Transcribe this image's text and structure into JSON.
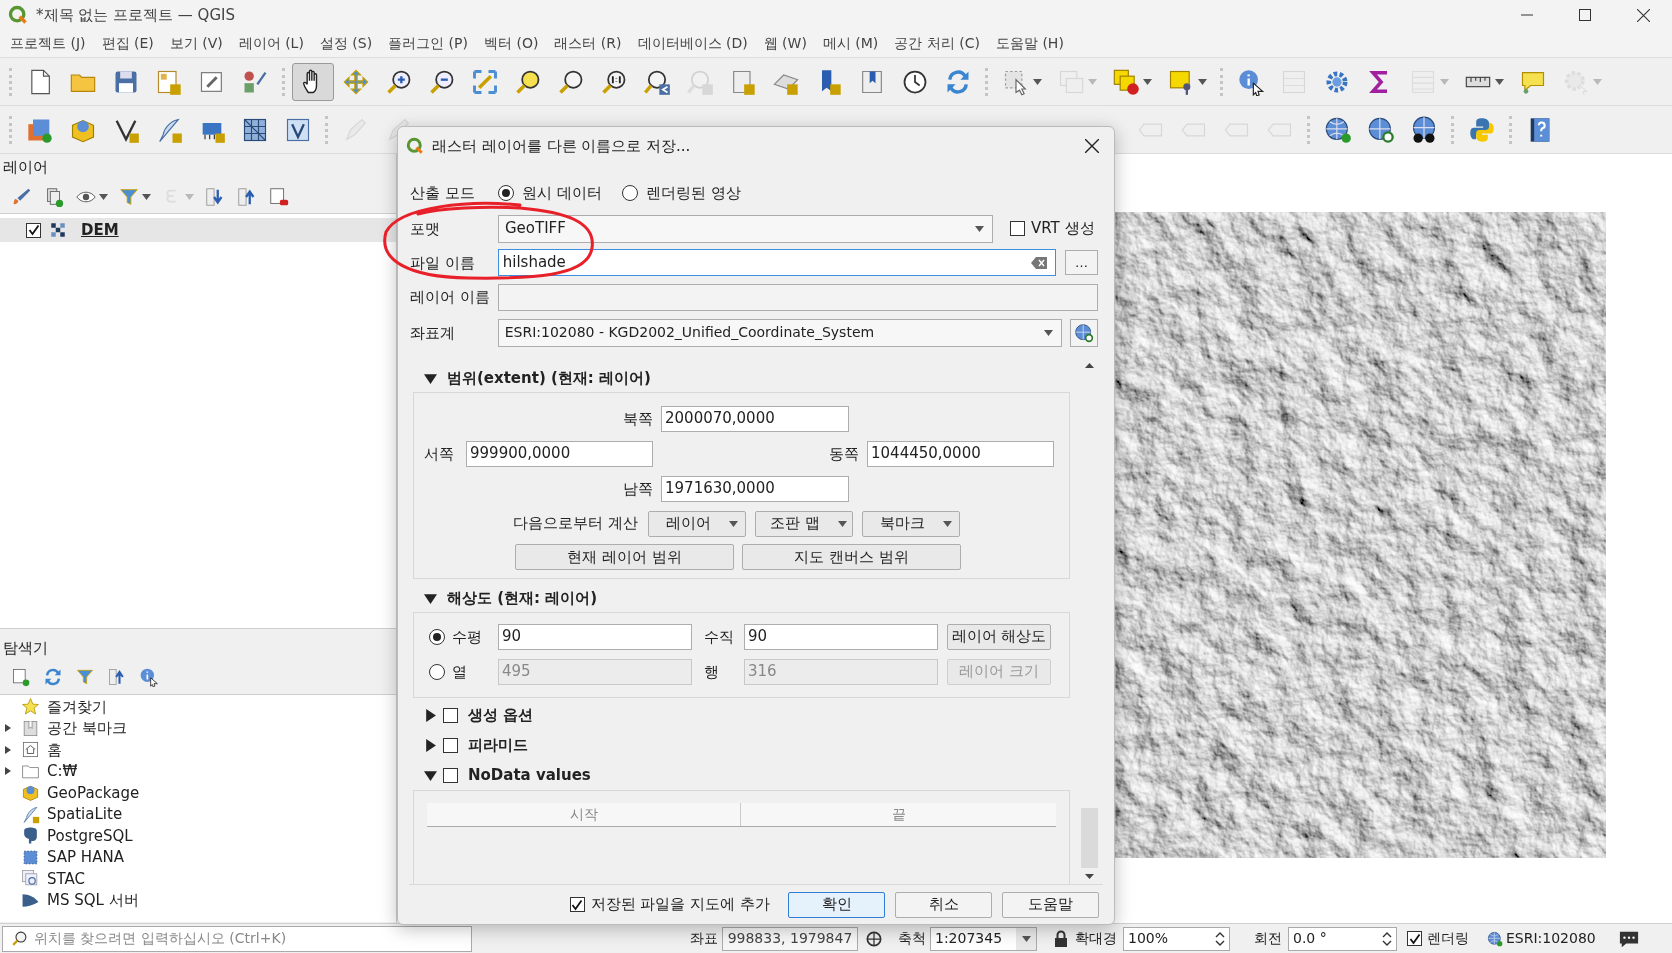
{
  "window": {
    "title": "*제목 없는 프로젝트 — QGIS"
  },
  "menu": [
    "프로젝트 (J)",
    "편집 (E)",
    "보기 (V)",
    "레이어 (L)",
    "설정 (S)",
    "플러그인 (P)",
    "벡터 (O)",
    "래스터 (R)",
    "데이터베이스 (D)",
    "웹 (W)",
    "메시 (M)",
    "공간 처리 (C)",
    "도움말 (H)"
  ],
  "toolbars": [
    {
      "tools": [
        {
          "selected": false,
          "disabled": false
        },
        {
          "selected": false,
          "disabled": false
        },
        {
          "selected": false,
          "disabled": false
        },
        {
          "selected": false,
          "disabled": false
        },
        {
          "selected": false,
          "disabled": false
        },
        {
          "selected": false,
          "disabled": false
        },
        {
          "selected": true,
          "disabled": false
        },
        {
          "selected": false,
          "disabled": false
        },
        {
          "selected": false,
          "disabled": false
        },
        {
          "selected": false,
          "disabled": false
        },
        {
          "selected": false,
          "disabled": false
        },
        {
          "selected": false,
          "disabled": false
        },
        {
          "selected": false,
          "disabled": false
        },
        {
          "selected": false,
          "disabled": false
        },
        {
          "selected": false,
          "disabled": false
        },
        {
          "selected": false,
          "disabled": true
        },
        {
          "selected": false,
          "disabled": false
        },
        {
          "selected": false,
          "disabled": false
        },
        {
          "selected": false,
          "disabled": false
        },
        {
          "selected": false,
          "disabled": false
        },
        {
          "selected": false,
          "disabled": false
        },
        {
          "selected": false,
          "disabled": false
        },
        {
          "selected": false,
          "disabled": false
        },
        {
          "selected": false,
          "disabled": true
        },
        {
          "selected": false,
          "disabled": false
        },
        {
          "selected": false,
          "disabled": false
        },
        {
          "selected": false,
          "disabled": false
        },
        {
          "selected": false,
          "disabled": true
        },
        {
          "selected": false,
          "disabled": false
        },
        {
          "selected": false,
          "disabled": false
        },
        {
          "selected": false,
          "disabled": true
        },
        {
          "selected": false,
          "disabled": false
        },
        {
          "selected": false,
          "disabled": false
        },
        {
          "selected": false,
          "disabled": true
        }
      ]
    },
    {
      "tools": [
        {
          "selected": false,
          "disabled": false
        },
        {
          "selected": false,
          "disabled": false
        },
        {
          "selected": false,
          "disabled": false
        },
        {
          "selected": false,
          "disabled": false
        },
        {
          "selected": false,
          "disabled": false
        },
        {
          "selected": false,
          "disabled": false
        },
        {
          "selected": false,
          "disabled": false
        },
        {
          "selected": false,
          "disabled": true
        },
        {
          "selected": false,
          "disabled": true
        },
        {
          "selected": false,
          "disabled": true
        },
        {
          "selected": false,
          "disabled": true
        },
        {
          "selected": false,
          "disabled": true
        },
        {
          "selected": false,
          "disabled": true
        },
        {
          "selected": false,
          "disabled": false
        },
        {
          "selected": false,
          "disabled": false
        },
        {
          "selected": false,
          "disabled": false
        },
        {
          "selected": false,
          "disabled": false
        },
        {
          "selected": false,
          "disabled": false
        }
      ]
    }
  ],
  "layers_panel": {
    "title": "레이어",
    "tools": [
      {
        "disabled": false
      },
      {
        "disabled": false
      },
      {
        "disabled": false
      },
      {
        "disabled": false
      },
      {
        "disabled": true
      },
      {
        "disabled": false
      },
      {
        "disabled": false
      },
      {
        "disabled": false
      }
    ],
    "layers": [
      {
        "name": "DEM",
        "checked": true,
        "selected": true
      }
    ]
  },
  "browser_panel": {
    "title": "탐색기",
    "items": [
      {
        "label": "즐겨찾기",
        "expandable": false
      },
      {
        "label": "공간 북마크",
        "expandable": true
      },
      {
        "label": "홈",
        "expandable": true
      },
      {
        "label": "C:₩",
        "expandable": true
      },
      {
        "label": "GeoPackage",
        "expandable": false
      },
      {
        "label": "SpatiaLite",
        "expandable": false
      },
      {
        "label": "PostgreSQL",
        "expandable": false
      },
      {
        "label": "SAP HANA",
        "expandable": false
      },
      {
        "label": "STAC",
        "expandable": false
      },
      {
        "label": "MS SQL 서버",
        "expandable": false
      }
    ]
  },
  "dialog": {
    "title": "래스터 레이어를 다른 이름으로 저장...",
    "output_mode": {
      "label": "산출 모드",
      "options": [
        {
          "label": "원시 데이터",
          "selected": true
        },
        {
          "label": "렌더링된 영상",
          "selected": false
        }
      ]
    },
    "format": {
      "label": "포맷",
      "value": "GeoTIFF"
    },
    "vrt": {
      "label": "VRT 생성",
      "checked": false
    },
    "file_name": {
      "label": "파일 이름",
      "value": "hilshade"
    },
    "browse_button": "…",
    "layer_name": {
      "label": "레이어 이름"
    },
    "crs": {
      "label": "좌표계",
      "value": "ESRI:102080 - KGD2002_Unified_Coordinate_System"
    },
    "extent": {
      "title": "범위(extent) (현재: 레이어)",
      "expanded": true,
      "north": {
        "label": "북쪽",
        "value": "2000070,0000"
      },
      "west": {
        "label": "서쪽",
        "value": "999900,0000"
      },
      "east": {
        "label": "동쪽",
        "value": "1044450,0000"
      },
      "south": {
        "label": "남쪽",
        "value": "1971630,0000"
      },
      "calculate_label": "다음으로부터 계산",
      "calculate_buttons": [
        "레이어",
        "조판 맵",
        "북마크"
      ],
      "extent_buttons": [
        "현재 레이어 범위",
        "지도 캔버스 범위"
      ]
    },
    "resolution": {
      "title": "해상도 (현재: 레이어)",
      "expanded": true,
      "rows": [
        {
          "label": "수평",
          "selected": true,
          "disabled": false,
          "value": "90",
          "label2": "수직",
          "value2": "90",
          "button": "레이어 해상도"
        },
        {
          "label": "열",
          "selected": false,
          "disabled": true,
          "value": "495",
          "label2": "행",
          "value2": "316",
          "button": "레이어 크기"
        }
      ]
    },
    "sections": [
      {
        "title": "생성 옵션",
        "expanded": false,
        "checked": false
      },
      {
        "title": "피라미드",
        "expanded": false,
        "checked": false
      },
      {
        "title": "NoData values",
        "expanded": true,
        "checked": false,
        "columns": [
          "시작",
          "끝"
        ]
      }
    ],
    "add_to_map": {
      "label": "저장된 파일을 지도에 추가",
      "checked": true
    },
    "buttons": [
      {
        "label": "확인",
        "default": true
      },
      {
        "label": "취소",
        "default": false
      },
      {
        "label": "도움말",
        "default": false
      }
    ]
  },
  "locator": {
    "placeholder": "위치를 찾으려면 입력하십시오 (Ctrl+K)"
  },
  "status_bar": {
    "coordinate": {
      "label": "좌표",
      "value": "998833, 1979847"
    },
    "scale": {
      "label": "축척",
      "value": "1:207345"
    },
    "magnifier": {
      "label": "확대경",
      "value": "100%"
    },
    "rotation": {
      "label": "회전",
      "value": "0.0 °"
    },
    "render": {
      "label": "렌더링",
      "checked": true
    },
    "crs": "ESRI:102080"
  }
}
